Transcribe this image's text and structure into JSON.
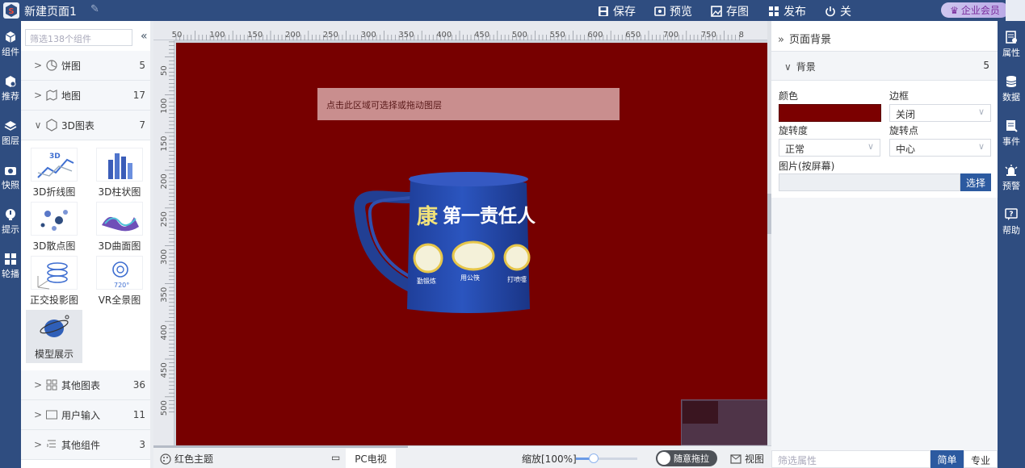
{
  "topbar": {
    "title": "新建页面1",
    "actions": [
      {
        "label": "保存",
        "icon": "save-icon"
      },
      {
        "label": "预览",
        "icon": "preview-icon"
      },
      {
        "label": "存图",
        "icon": "image-save-icon"
      },
      {
        "label": "发布",
        "icon": "publish-icon"
      },
      {
        "label": "关",
        "icon": "power-icon"
      }
    ],
    "member": "企业会员"
  },
  "left_rail": [
    {
      "label": "组件",
      "icon": "cube-icon"
    },
    {
      "label": "推荐",
      "icon": "recommend-icon"
    },
    {
      "label": "图层",
      "icon": "layers-icon"
    },
    {
      "label": "快照",
      "icon": "camera-icon"
    },
    {
      "label": "提示",
      "icon": "tip-icon"
    },
    {
      "label": "轮播",
      "icon": "windows-icon"
    }
  ],
  "components": {
    "search_placeholder": "筛选138个组件",
    "collapse": "«",
    "categories_top": [
      {
        "label": "饼图",
        "count": "5",
        "icon": "pie-icon",
        "chev": ">"
      },
      {
        "label": "地图",
        "count": "17",
        "icon": "map-icon",
        "chev": ">"
      },
      {
        "label": "3D图表",
        "count": "7",
        "icon": "cube3d-icon",
        "chev": "∨"
      }
    ],
    "tiles": [
      {
        "label": "3D折线图",
        "icon": "3d-line-chart-icon"
      },
      {
        "label": "3D柱状图",
        "icon": "3d-bar-chart-icon"
      },
      {
        "label": "3D散点图",
        "icon": "3d-scatter-icon"
      },
      {
        "label": "3D曲面图",
        "icon": "3d-surface-icon"
      },
      {
        "label": "正交投影图",
        "icon": "ortho-projection-icon"
      },
      {
        "label": "VR全景图",
        "icon": "vr-panorama-icon"
      },
      {
        "label": "模型展示",
        "icon": "model-display-icon"
      }
    ],
    "categories_bottom": [
      {
        "label": "其他图表",
        "count": "36",
        "icon": "other-chart-icon",
        "chev": ">"
      },
      {
        "label": "用户输入",
        "count": "11",
        "icon": "input-icon",
        "chev": ">"
      },
      {
        "label": "其他组件",
        "count": "3",
        "icon": "other-component-icon",
        "chev": ">"
      }
    ]
  },
  "ruler": {
    "top": [
      "50",
      "100",
      "150",
      "200",
      "250",
      "300",
      "350",
      "400",
      "450",
      "500",
      "550",
      "600",
      "650",
      "700",
      "750",
      "8"
    ],
    "left": [
      "50",
      "100",
      "150",
      "200",
      "250",
      "300",
      "350",
      "400",
      "450",
      "500"
    ]
  },
  "canvas": {
    "hint": "点击此区域可选择或拖动图层",
    "background": "#770000",
    "mug_text": "康 第一责任人",
    "mug_labels": [
      "勤锻炼",
      "用公筷",
      "打喷嚏"
    ]
  },
  "bottombar": {
    "theme": "红色主题",
    "device": "PC电视",
    "zoom": "缩放[100%]",
    "zoom_level": 0.3,
    "drag": "随意拖拉",
    "view": "视图"
  },
  "props": {
    "header": "页面背景",
    "section": "背景",
    "section_count": "5",
    "color_label": "颜色",
    "color_value": "#7b0000",
    "border_label": "边框",
    "border_value": "关闭",
    "rotation_label": "旋转度",
    "rotation_value": "正常",
    "pivot_label": "旋转点",
    "pivot_value": "中心",
    "image_label": "图片(按屏幕)",
    "choose": "选择",
    "filter_placeholder": "筛选属性",
    "simple": "简单",
    "pro": "专业"
  },
  "right_rail": [
    {
      "label": "属性",
      "icon": "properties-icon"
    },
    {
      "label": "数据",
      "icon": "database-icon"
    },
    {
      "label": "事件",
      "icon": "event-icon"
    },
    {
      "label": "预警",
      "icon": "alarm-icon"
    },
    {
      "label": "帮助",
      "icon": "help-icon"
    }
  ]
}
